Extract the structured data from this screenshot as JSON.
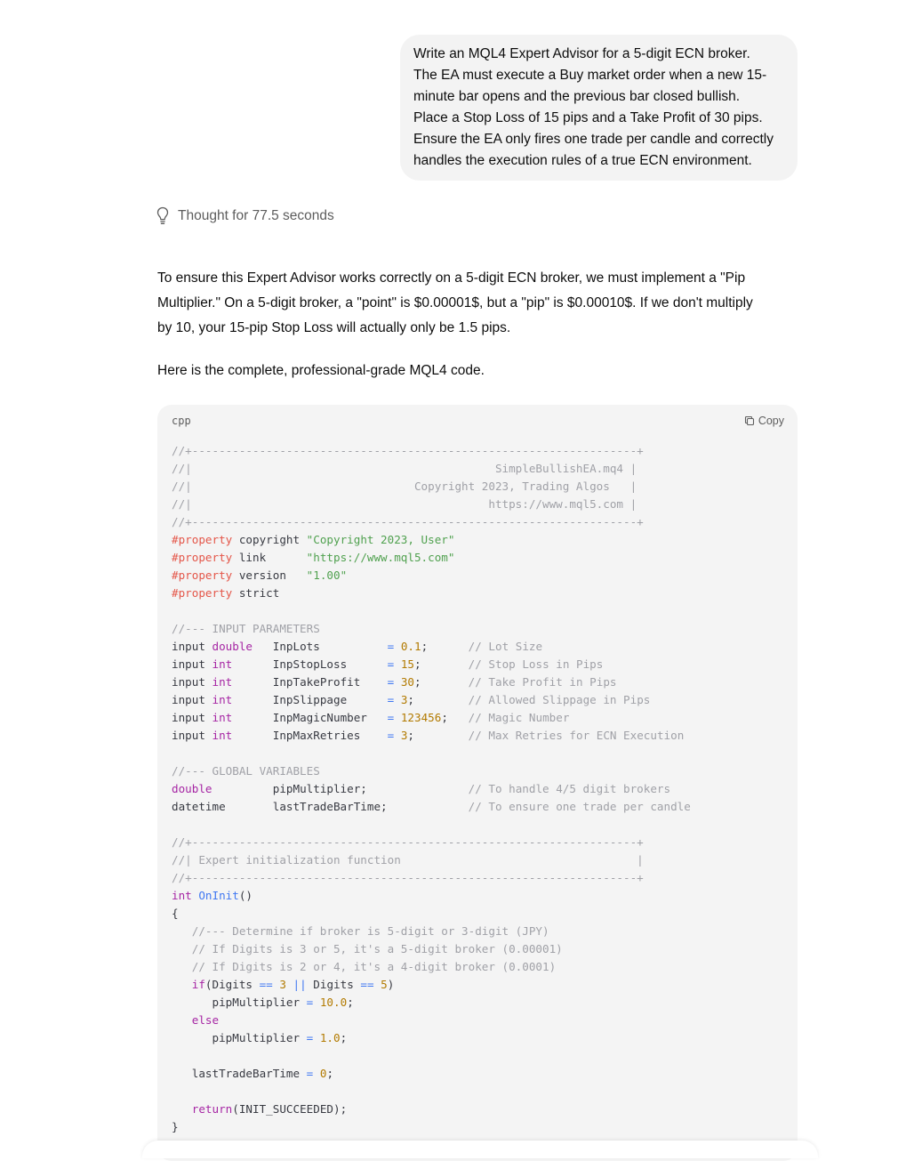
{
  "user_message": "Write an MQL4 Expert Advisor for a 5-digit ECN broker.\nThe EA must execute a Buy market order when a new 15-\nminute bar opens and the previous bar closed bullish.\nPlace a Stop Loss of 15 pips and a Take Profit of 30 pips.\nEnsure the EA only fires one trade per candle and correctly\nhandles the execution rules of a true ECN environment.",
  "thought": {
    "icon": "lightbulb-icon",
    "label": "Thought for 77.5 seconds"
  },
  "answer": {
    "paragraph_1": "To ensure this Expert Advisor works correctly on a 5-digit ECN broker, we must implement a \"Pip\nMultiplier.\" On a 5-digit broker, a \"point\" is $0.00001$, but a \"pip\" is $0.00010$. If we don't multiply\nby 10, your 15-pip Stop Loss will actually only be 1.5 pips.",
    "paragraph_2": "Here is the complete, professional-grade MQL4 code."
  },
  "code_block": {
    "language": "cpp",
    "copy_label": "Copy",
    "copy_icon": "copy-icon",
    "lines": [
      [
        [
          "c",
          "//+------------------------------------------------------------------+"
        ]
      ],
      [
        [
          "c",
          "//|                                             SimpleBullishEA.mq4 |"
        ]
      ],
      [
        [
          "c",
          "//|                                 Copyright 2023, Trading Algos   |"
        ]
      ],
      [
        [
          "c",
          "//|                                            https://www.mql5.com |"
        ]
      ],
      [
        [
          "c",
          "//+------------------------------------------------------------------+"
        ]
      ],
      [
        [
          "pp",
          "#property"
        ],
        [
          "tx",
          " copyright "
        ],
        [
          "st",
          "\"Copyright 2023, User\""
        ]
      ],
      [
        [
          "pp",
          "#property"
        ],
        [
          "tx",
          " link      "
        ],
        [
          "st",
          "\"https://www.mql5.com\""
        ]
      ],
      [
        [
          "pp",
          "#property"
        ],
        [
          "tx",
          " version   "
        ],
        [
          "st",
          "\"1.00\""
        ]
      ],
      [
        [
          "pp",
          "#property"
        ],
        [
          "tx",
          " strict"
        ]
      ],
      [],
      [
        [
          "c",
          "//--- INPUT PARAMETERS"
        ]
      ],
      [
        [
          "tx",
          "input "
        ],
        [
          "kw",
          "double"
        ],
        [
          "tx",
          "   InpLots          "
        ],
        [
          "op",
          "="
        ],
        [
          "tx",
          " "
        ],
        [
          "nm",
          "0.1"
        ],
        [
          "tx",
          ";      "
        ],
        [
          "c",
          "// Lot Size"
        ]
      ],
      [
        [
          "tx",
          "input "
        ],
        [
          "kw",
          "int"
        ],
        [
          "tx",
          "      InpStopLoss      "
        ],
        [
          "op",
          "="
        ],
        [
          "tx",
          " "
        ],
        [
          "nm",
          "15"
        ],
        [
          "tx",
          ";       "
        ],
        [
          "c",
          "// Stop Loss in Pips"
        ]
      ],
      [
        [
          "tx",
          "input "
        ],
        [
          "kw",
          "int"
        ],
        [
          "tx",
          "      InpTakeProfit    "
        ],
        [
          "op",
          "="
        ],
        [
          "tx",
          " "
        ],
        [
          "nm",
          "30"
        ],
        [
          "tx",
          ";       "
        ],
        [
          "c",
          "// Take Profit in Pips"
        ]
      ],
      [
        [
          "tx",
          "input "
        ],
        [
          "kw",
          "int"
        ],
        [
          "tx",
          "      InpSlippage      "
        ],
        [
          "op",
          "="
        ],
        [
          "tx",
          " "
        ],
        [
          "nm",
          "3"
        ],
        [
          "tx",
          ";        "
        ],
        [
          "c",
          "// Allowed Slippage in Pips"
        ]
      ],
      [
        [
          "tx",
          "input "
        ],
        [
          "kw",
          "int"
        ],
        [
          "tx",
          "      InpMagicNumber   "
        ],
        [
          "op",
          "="
        ],
        [
          "tx",
          " "
        ],
        [
          "nm",
          "123456"
        ],
        [
          "tx",
          ";   "
        ],
        [
          "c",
          "// Magic Number"
        ]
      ],
      [
        [
          "tx",
          "input "
        ],
        [
          "kw",
          "int"
        ],
        [
          "tx",
          "      InpMaxRetries    "
        ],
        [
          "op",
          "="
        ],
        [
          "tx",
          " "
        ],
        [
          "nm",
          "3"
        ],
        [
          "tx",
          ";        "
        ],
        [
          "c",
          "// Max Retries for ECN Execution"
        ]
      ],
      [],
      [
        [
          "c",
          "//--- GLOBAL VARIABLES"
        ]
      ],
      [
        [
          "kw",
          "double"
        ],
        [
          "tx",
          "         pipMultiplier;               "
        ],
        [
          "c",
          "// To handle 4/5 digit brokers"
        ]
      ],
      [
        [
          "tx",
          "datetime       lastTradeBarTime;            "
        ],
        [
          "c",
          "// To ensure one trade per candle"
        ]
      ],
      [],
      [
        [
          "c",
          "//+------------------------------------------------------------------+"
        ]
      ],
      [
        [
          "c",
          "//| Expert initialization function                                   |"
        ]
      ],
      [
        [
          "c",
          "//+------------------------------------------------------------------+"
        ]
      ],
      [
        [
          "kw",
          "int"
        ],
        [
          "tx",
          " "
        ],
        [
          "fn",
          "OnInit"
        ],
        [
          "tx",
          "()"
        ]
      ],
      [
        [
          "tx",
          "{"
        ]
      ],
      [
        [
          "c",
          "   //--- Determine if broker is 5-digit or 3-digit (JPY)"
        ]
      ],
      [
        [
          "c",
          "   // If Digits is 3 or 5, it's a 5-digit broker (0.00001)"
        ]
      ],
      [
        [
          "c",
          "   // If Digits is 2 or 4, it's a 4-digit broker (0.0001)"
        ]
      ],
      [
        [
          "tx",
          "   "
        ],
        [
          "kw",
          "if"
        ],
        [
          "tx",
          "(Digits "
        ],
        [
          "op",
          "=="
        ],
        [
          "tx",
          " "
        ],
        [
          "nm",
          "3"
        ],
        [
          "tx",
          " "
        ],
        [
          "op",
          "||"
        ],
        [
          "tx",
          " Digits "
        ],
        [
          "op",
          "=="
        ],
        [
          "tx",
          " "
        ],
        [
          "nm",
          "5"
        ],
        [
          "tx",
          ")"
        ]
      ],
      [
        [
          "tx",
          "      pipMultiplier "
        ],
        [
          "op",
          "="
        ],
        [
          "tx",
          " "
        ],
        [
          "nm",
          "10.0"
        ],
        [
          "tx",
          ";"
        ]
      ],
      [
        [
          "tx",
          "   "
        ],
        [
          "kw",
          "else"
        ]
      ],
      [
        [
          "tx",
          "      pipMultiplier "
        ],
        [
          "op",
          "="
        ],
        [
          "tx",
          " "
        ],
        [
          "nm",
          "1.0"
        ],
        [
          "tx",
          ";"
        ]
      ],
      [],
      [
        [
          "tx",
          "   lastTradeBarTime "
        ],
        [
          "op",
          "="
        ],
        [
          "tx",
          " "
        ],
        [
          "nm",
          "0"
        ],
        [
          "tx",
          ";"
        ]
      ],
      [],
      [
        [
          "tx",
          "   "
        ],
        [
          "kw",
          "return"
        ],
        [
          "tx",
          "(INIT_SUCCEEDED);"
        ]
      ],
      [
        [
          "tx",
          "}"
        ]
      ]
    ]
  }
}
